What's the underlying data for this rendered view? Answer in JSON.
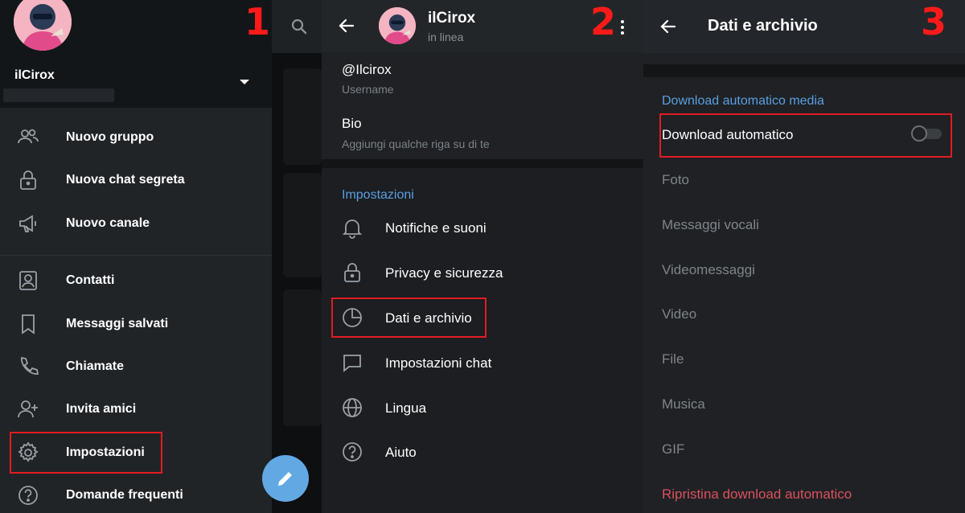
{
  "step_numbers": [
    "1",
    "2",
    "3"
  ],
  "colors": {
    "accent": "#5b9fe0",
    "highlight": "#e21b22",
    "danger": "#d9515e",
    "fab": "#62a9e4"
  },
  "panel1": {
    "drawer": {
      "name": "ilCirox"
    },
    "menu": [
      {
        "label": "Nuovo gruppo",
        "icon": "group-icon"
      },
      {
        "label": "Nuova chat segreta",
        "icon": "lock-icon"
      },
      {
        "label": "Nuovo canale",
        "icon": "megaphone-icon"
      },
      {
        "label": "Contatti",
        "icon": "contact-icon"
      },
      {
        "label": "Messaggi salvati",
        "icon": "bookmark-icon"
      },
      {
        "label": "Chiamate",
        "icon": "phone-icon"
      },
      {
        "label": "Invita amici",
        "icon": "add-user-icon"
      },
      {
        "label": "Impostazioni",
        "icon": "gear-icon"
      },
      {
        "label": "Domande frequenti",
        "icon": "help-icon"
      }
    ]
  },
  "panel2": {
    "header": {
      "name": "ilCirox",
      "status": "in linea"
    },
    "username": {
      "value": "@Ilcirox",
      "label": "Username"
    },
    "bio": {
      "value": "Bio",
      "placeholder": "Aggiungi qualche riga su di te"
    },
    "section_title": "Impostazioni",
    "items": [
      {
        "label": "Notifiche e suoni",
        "icon": "bell-icon"
      },
      {
        "label": "Privacy e sicurezza",
        "icon": "lock-icon"
      },
      {
        "label": "Dati e archivio",
        "icon": "pie-chart-icon"
      },
      {
        "label": "Impostazioni chat",
        "icon": "chat-bubble-icon"
      },
      {
        "label": "Lingua",
        "icon": "globe-icon"
      },
      {
        "label": "Aiuto",
        "icon": "help-icon"
      }
    ]
  },
  "panel3": {
    "title": "Dati e archivio",
    "section_title": "Download automatico media",
    "auto_download": {
      "label": "Download automatico",
      "enabled": false
    },
    "options": [
      "Foto",
      "Messaggi vocali",
      "Videomessaggi",
      "Video",
      "File",
      "Musica",
      "GIF"
    ],
    "reset_label": "Ripristina download automatico"
  }
}
